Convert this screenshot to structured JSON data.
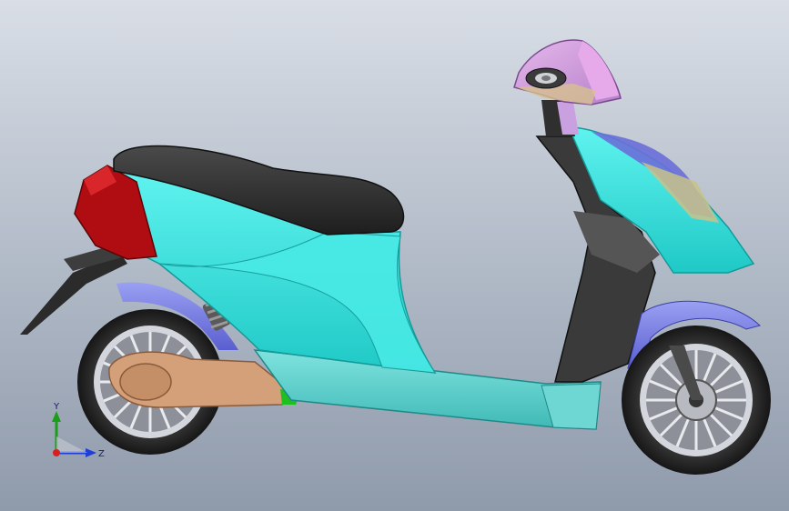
{
  "viewport": {
    "background_top": "#d9dee6",
    "background_bottom": "#8f9aab"
  },
  "model": {
    "colors": {
      "body_cyan": "#3fe6e2",
      "body_cyan_dark": "#22b8b8",
      "floorboard": "#5fd2cf",
      "seat": "#2f2f2f",
      "tail_light": "#b00d12",
      "fender": "#7a7ee6",
      "swingarm": "#d4a07a",
      "headlight_housing": "#d7a0e0",
      "front_fork": "#4a4a4a",
      "tyre": "#262626",
      "rim": "#b9bcc2",
      "green_part": "#1fbf1f"
    }
  },
  "triad": {
    "y_label": "Y",
    "z_label": "Z",
    "icon": "coordinate-triad-icon"
  }
}
